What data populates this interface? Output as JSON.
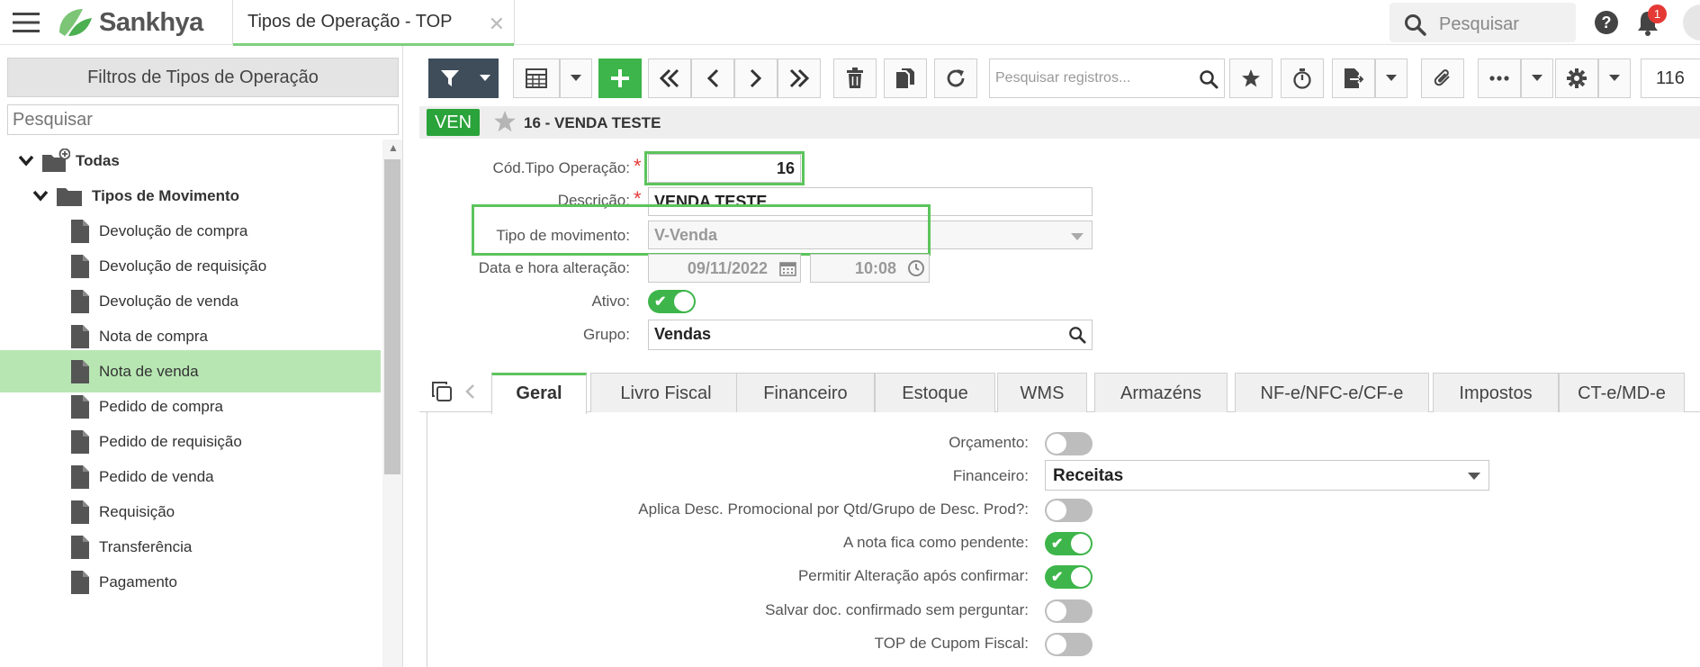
{
  "topbar": {
    "brand": "Sankhya",
    "tab_title": "Tipos de Operação - TOP",
    "search_placeholder": "Pesquisar",
    "notification_count": "1",
    "accent_color": "#3db54a"
  },
  "left_panel": {
    "header": "Filtros de Tipos de Operação",
    "search_placeholder": "Pesquisar",
    "tree": {
      "root": "Todas",
      "group": "Tipos de Movimento",
      "items": [
        "Devolução de compra",
        "Devolução de requisição",
        "Devolução de venda",
        "Nota de compra",
        "Nota de venda",
        "Pedido de compra",
        "Pedido de requisição",
        "Pedido de venda",
        "Requisição",
        "Transferência",
        "Pagamento"
      ],
      "selected": "Nota de venda"
    }
  },
  "toolbar": {
    "search_placeholder": "Pesquisar registros...",
    "page_value": "116"
  },
  "record": {
    "badge": "VEN",
    "title": "16 - VENDA TESTE"
  },
  "form": {
    "cod_label": "Cód.Tipo Operação:",
    "cod_value": "16",
    "descricao_label": "Descrição:",
    "descricao_value": "VENDA TESTE",
    "tipo_label": "Tipo de movimento:",
    "tipo_value": "V-Venda",
    "data_label": "Data e hora alteração:",
    "data_value": "09/11/2022",
    "hora_value": "10:08",
    "ativo_label": "Ativo:",
    "ativo_on": true,
    "grupo_label": "Grupo:",
    "grupo_value": "Vendas"
  },
  "tabs": [
    "Geral",
    "Livro Fiscal",
    "Financeiro",
    "Estoque",
    "WMS",
    "Armazéns",
    "NF-e/NFC-e/CF-e",
    "Impostos",
    "CT-e/MD-e"
  ],
  "active_tab": "Geral",
  "geral": {
    "orcamento_label": "Orçamento:",
    "orcamento_on": false,
    "financeiro_label": "Financeiro:",
    "financeiro_value": "Receitas",
    "aplica_label": "Aplica Desc. Promocional por Qtd/Grupo de Desc. Prod?:",
    "aplica_on": false,
    "pendente_label": "A nota fica como pendente:",
    "pendente_on": true,
    "permitir_label": "Permitir Alteração após confirmar:",
    "permitir_on": true,
    "salvar_label": "Salvar doc. confirmado sem perguntar:",
    "salvar_on": false,
    "cupom_label": "TOP de Cupom Fiscal:",
    "cupom_on": false
  }
}
